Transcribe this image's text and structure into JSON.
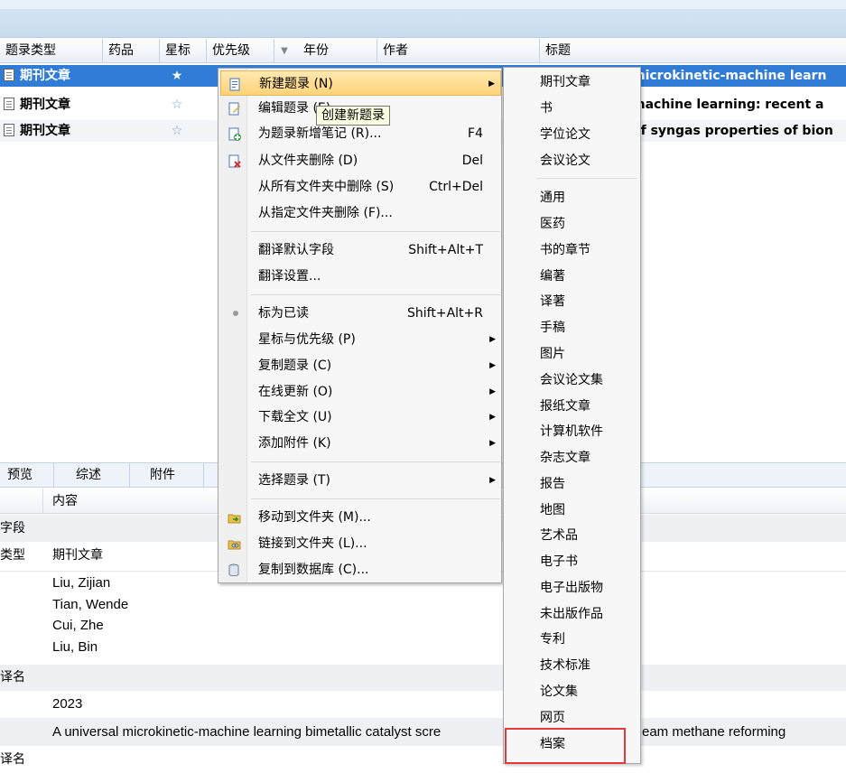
{
  "columns": [
    "题录类型",
    "药品",
    "星标",
    "优先级",
    "年份",
    "作者",
    "标题"
  ],
  "rows": [
    {
      "type": "期刊文章",
      "title": "microkinetic-machine learn",
      "starred": true,
      "selected": true
    },
    {
      "type": "期刊文章",
      "title": "machine learning: recent a",
      "starred": false,
      "selected": false
    },
    {
      "type": "期刊文章",
      "title": "of syngas properties of bion",
      "starred": false,
      "selected": false
    }
  ],
  "tabs": [
    "预览",
    "综述",
    "附件"
  ],
  "info": {
    "content_header": "内容",
    "rows": [
      {
        "label": "字段",
        "value": ""
      },
      {
        "label": "类型",
        "value": "期刊文章"
      },
      {
        "label": "",
        "value": "Liu, Zijian"
      },
      {
        "label": "",
        "value": "Tian, Wende"
      },
      {
        "label": "",
        "value": "Cui, Zhe"
      },
      {
        "label": "",
        "value": "Liu, Bin"
      },
      {
        "label": "译名",
        "value": ""
      },
      {
        "label": "",
        "value": "2023"
      },
      {
        "label": "",
        "value": "A universal microkinetic-machine learning bimetallic catalyst scre"
      },
      {
        "label": "译名",
        "value": ""
      }
    ],
    "title_tail": "eam methane reforming"
  },
  "context_menu": {
    "items": [
      {
        "label": "新建题录 (N)",
        "shortcut": "",
        "submenu": true
      },
      {
        "label": "编辑题录 (E)",
        "shortcut": "",
        "submenu": false
      },
      {
        "label": "为题录新增笔记 (R)...",
        "shortcut": "F4",
        "submenu": false
      },
      {
        "label": "从文件夹删除 (D)",
        "shortcut": "Del",
        "submenu": false
      },
      {
        "label": "从所有文件夹中删除 (S)",
        "shortcut": "Ctrl+Del",
        "submenu": false
      },
      {
        "label": "从指定文件夹删除 (F)...",
        "shortcut": "",
        "submenu": false
      },
      {
        "label": "翻译默认字段",
        "shortcut": "Shift+Alt+T",
        "submenu": false
      },
      {
        "label": "翻译设置...",
        "shortcut": "",
        "submenu": false
      },
      {
        "label": "标为已读",
        "shortcut": "Shift+Alt+R",
        "submenu": false
      },
      {
        "label": "星标与优先级 (P)",
        "shortcut": "",
        "submenu": true
      },
      {
        "label": "复制题录 (C)",
        "shortcut": "",
        "submenu": true
      },
      {
        "label": "在线更新 (O)",
        "shortcut": "",
        "submenu": true
      },
      {
        "label": "下载全文 (U)",
        "shortcut": "",
        "submenu": true
      },
      {
        "label": "添加附件 (K)",
        "shortcut": "",
        "submenu": true
      },
      {
        "label": "选择题录 (T)",
        "shortcut": "",
        "submenu": true
      },
      {
        "label": "移动到文件夹 (M)...",
        "shortcut": "",
        "submenu": false
      },
      {
        "label": "链接到文件夹 (L)...",
        "shortcut": "",
        "submenu": false
      },
      {
        "label": "复制到数据库 (C)...",
        "shortcut": "",
        "submenu": false
      }
    ],
    "tooltip": "创建新题录"
  },
  "submenu": {
    "items": [
      "期刊文章",
      "书",
      "学位论文",
      "会议论文",
      "通用",
      "医药",
      "书的章节",
      "编著",
      "译著",
      "手稿",
      "图片",
      "会议论文集",
      "报纸文章",
      "计算机软件",
      "杂志文章",
      "报告",
      "地图",
      "艺术品",
      "电子书",
      "电子出版物",
      "未出版作品",
      "专利",
      "技术标准",
      "论文集",
      "网页",
      "档案"
    ]
  },
  "colors": {
    "selection": "#2f7bd6",
    "highlight_box": "#e03a3a",
    "menu_hover": "#ffd27a"
  }
}
